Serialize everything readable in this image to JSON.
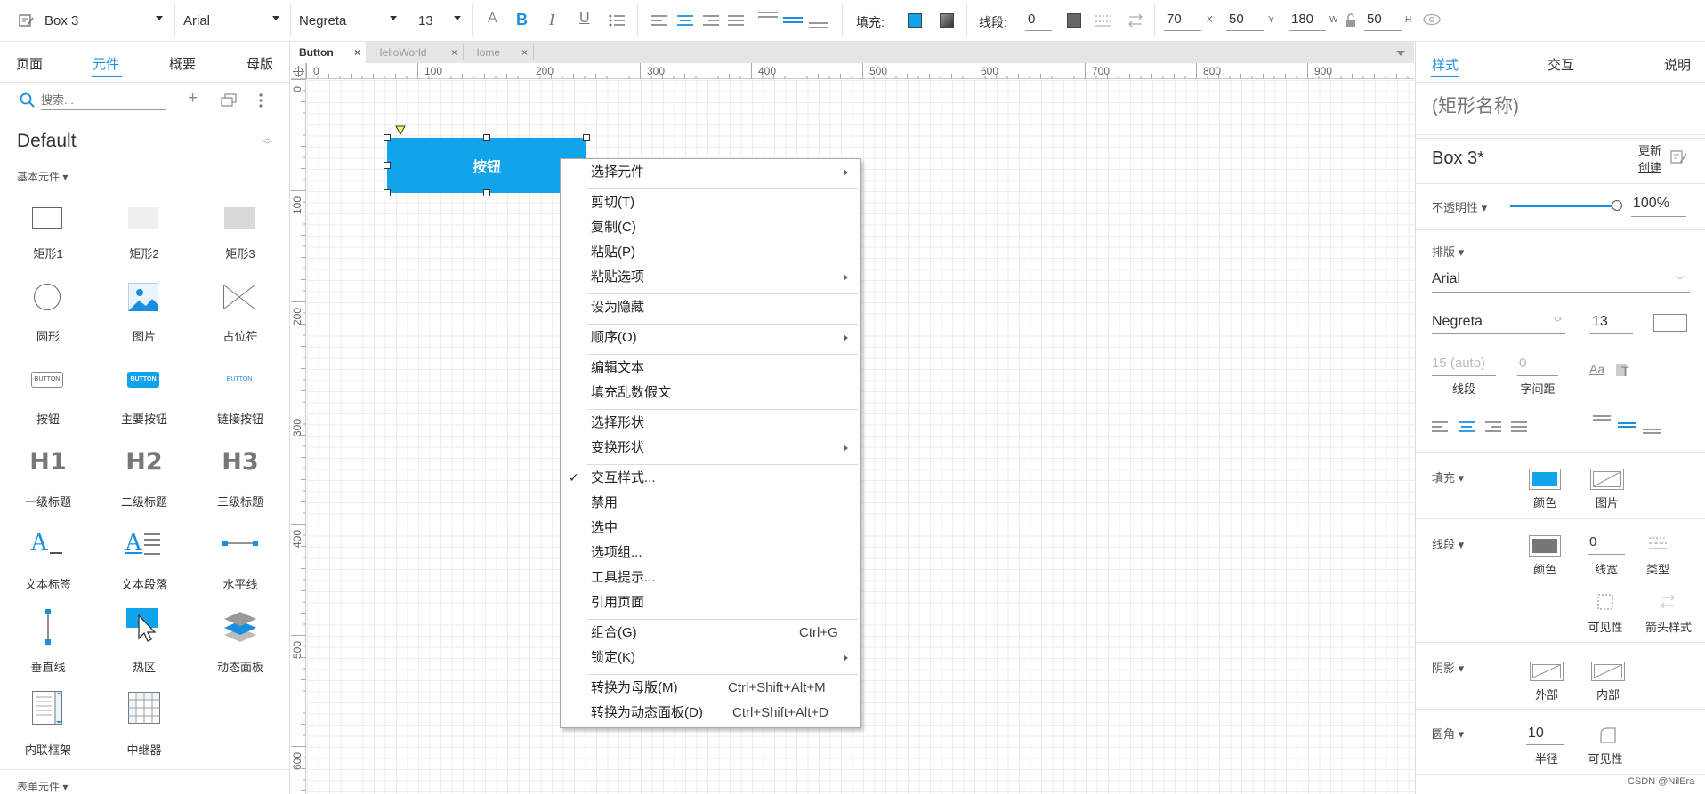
{
  "toolbar": {
    "element_name": "Box 3",
    "font_family": "Arial",
    "font_weight": "Negreta",
    "font_size": "13",
    "fill_label": "填充:",
    "line_label": "线段:",
    "line_width": "0",
    "x": "70",
    "x_label": "X",
    "y": "50",
    "y_label": "Y",
    "w": "180",
    "w_label": "W",
    "h": "50",
    "h_label": "H",
    "fill_color": "#11a4ea",
    "line_color": "#666666"
  },
  "left_panel": {
    "tabs": [
      "页面",
      "元件",
      "概要",
      "母版"
    ],
    "active_tab": "元件",
    "search_placeholder": "搜索...",
    "library": "Default",
    "section_basic": "基本元件 ▾",
    "section_form": "表单元件 ▾",
    "widgets": [
      {
        "label": "矩形1",
        "icon": "rectangle1-icon"
      },
      {
        "label": "矩形2",
        "icon": "rectangle2-icon"
      },
      {
        "label": "矩形3",
        "icon": "rectangle3-icon"
      },
      {
        "label": "圆形",
        "icon": "ellipse-icon"
      },
      {
        "label": "图片",
        "icon": "image-icon"
      },
      {
        "label": "占位符",
        "icon": "placeholder-icon"
      },
      {
        "label": "按钮",
        "icon": "button-icon",
        "icon_text": "BUTTON"
      },
      {
        "label": "主要按钮",
        "icon": "primary-button-icon",
        "icon_text": "BUTTON"
      },
      {
        "label": "链接按钮",
        "icon": "link-button-icon",
        "icon_text": "BUTTON"
      },
      {
        "label": "一级标题",
        "icon": "heading1-icon",
        "icon_text": "H1"
      },
      {
        "label": "二级标题",
        "icon": "heading2-icon",
        "icon_text": "H2"
      },
      {
        "label": "三级标题",
        "icon": "heading3-icon",
        "icon_text": "H3"
      },
      {
        "label": "文本标签",
        "icon": "text-label-icon",
        "icon_text": "A"
      },
      {
        "label": "文本段落",
        "icon": "paragraph-icon",
        "icon_text": "A"
      },
      {
        "label": "水平线",
        "icon": "horizontal-line-icon"
      },
      {
        "label": "垂直线",
        "icon": "vertical-line-icon"
      },
      {
        "label": "热区",
        "icon": "hotspot-icon"
      },
      {
        "label": "动态面板",
        "icon": "dynamic-panel-icon"
      },
      {
        "label": "内联框架",
        "icon": "inline-frame-icon"
      },
      {
        "label": "中继器",
        "icon": "repeater-icon"
      }
    ]
  },
  "file_tabs": [
    "Button",
    "HelloWorld",
    "Home"
  ],
  "active_file_tab": "Button",
  "ruler": {
    "h_ticks": [
      "0",
      "100",
      "200",
      "300",
      "400",
      "500",
      "600",
      "700",
      "800",
      "900"
    ],
    "v_ticks": [
      "0",
      "100",
      "200",
      "300",
      "400",
      "500",
      "600"
    ]
  },
  "canvas": {
    "box_text": "按钮",
    "box_color": "#11a4ea"
  },
  "context_menu": {
    "items": [
      {
        "label": "选择元件",
        "submenu": true
      },
      {
        "label": "剪切(T)"
      },
      {
        "label": "复制(C)"
      },
      {
        "label": "粘贴(P)"
      },
      {
        "label": "粘贴选项",
        "submenu": true
      },
      {
        "label": "设为隐藏"
      },
      {
        "label": "顺序(O)",
        "submenu": true
      },
      {
        "label": "编辑文本"
      },
      {
        "label": "填充乱数假文"
      },
      {
        "label": "选择形状"
      },
      {
        "label": "变换形状",
        "submenu": true
      },
      {
        "label": "交互样式...",
        "checked": true
      },
      {
        "label": "禁用"
      },
      {
        "label": "选中"
      },
      {
        "label": "选项组..."
      },
      {
        "label": "工具提示..."
      },
      {
        "label": "引用页面"
      },
      {
        "label": "组合(G)",
        "shortcut": "Ctrl+G"
      },
      {
        "label": "锁定(K)",
        "submenu": true
      },
      {
        "label": "转换为母版(M)",
        "shortcut": "Ctrl+Shift+Alt+M"
      },
      {
        "label": "转换为动态面板(D)",
        "shortcut": "Ctrl+Shift+Alt+D"
      }
    ]
  },
  "right_panel": {
    "tabs": [
      "样式",
      "交互",
      "说明"
    ],
    "active_tab": "样式",
    "name_placeholder": "(矩形名称)",
    "style_name": "Box 3*",
    "update_label_1": "更新",
    "update_label_2": "创建",
    "opacity_label": "不透明性 ▾",
    "opacity_value": "100%",
    "typography_label": "排版 ▾",
    "font_family": "Arial",
    "font_weight": "Negreta",
    "font_size": "13",
    "line_height_placeholder": "15 (auto)",
    "line_height_label": "线段",
    "char_spacing_placeholder": "0",
    "char_spacing_label": "字间距",
    "fill_label": "填充 ▾",
    "fill_color_label": "颜色",
    "fill_image_label": "图片",
    "border_label": "线段 ▾",
    "border_color_label": "颜色",
    "border_width": "0",
    "border_width_label": "线宽",
    "border_type_label": "类型",
    "visibility_label": "可见性",
    "arrow_label": "箭头样式",
    "shadow_label": "阴影 ▾",
    "shadow_outer_label": "外部",
    "shadow_inner_label": "内部",
    "corner_label": "圆角 ▾",
    "corner_radius": "10",
    "corner_radius_label": "半径",
    "corner_visibility_label": "可见性",
    "fill_color": "#11a4ea",
    "border_color": "#777777"
  },
  "watermark": "CSDN @NilEra"
}
